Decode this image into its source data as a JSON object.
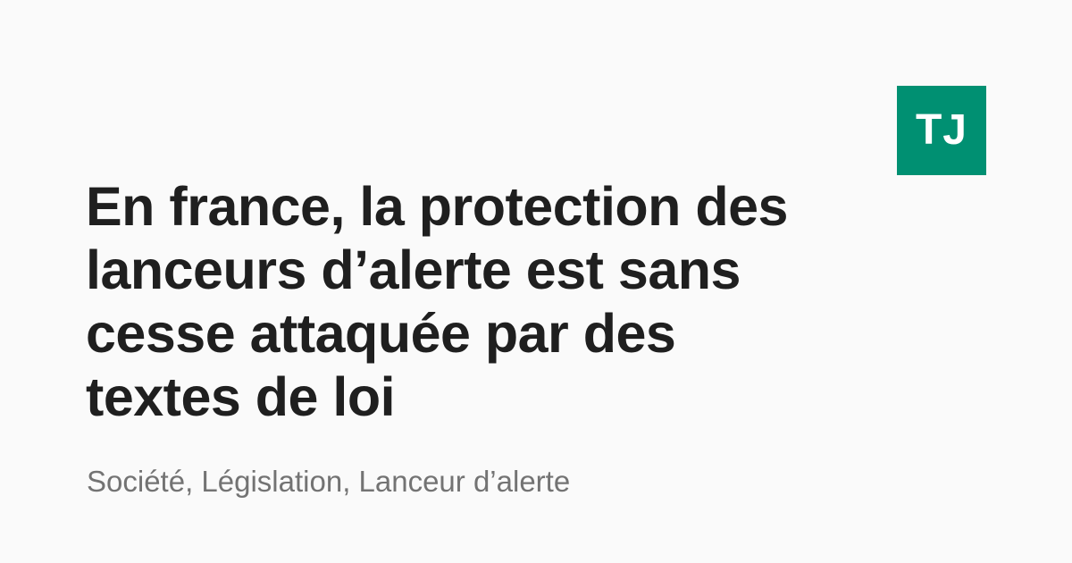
{
  "brand": {
    "logo_text": "TJ",
    "logo_color": "#009072",
    "logo_text_color": "#ffffff"
  },
  "article": {
    "title_lines": [
      "En france, la protection des",
      "lanceurs d’alerte est sans",
      "cesse attaquée par des",
      "textes de loi"
    ],
    "tags": "Société, Législation, Lanceur d’alerte"
  },
  "colors": {
    "background": "#fafafa",
    "title": "#1f1f1f",
    "tags": "#737373"
  }
}
